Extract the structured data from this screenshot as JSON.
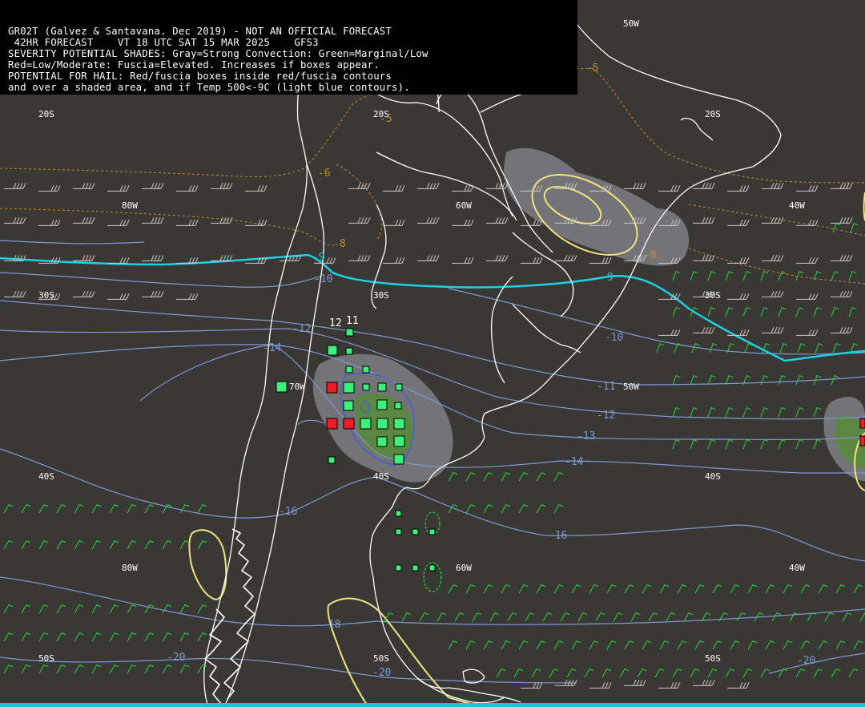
{
  "header": {
    "lines": [
      "GR02T (Galvez & Santavana. Dec 2019) - NOT AN OFFICIAL FORECAST",
      " 42HR FORECAST    VT 18 UTC SAT 15 MAR 2025    GFS3",
      "SEVERITY POTENTIAL SHADES: Gray=Strong Convection: Green=Marginal/Low",
      "Red=Low/Moderate: Fuscia=Elevated. Increases if boxes appear.",
      "POTENTIAL FOR HAIL: Red/fuscia boxes inside red/fuscia contours",
      "and over a shaded area, and if Temp 500<-9C (light blue contours)."
    ]
  },
  "grid_labels": {
    "lat_20s": "20S",
    "lat_30s": "30S",
    "lat_40s": "40S",
    "lat_50s": "50S",
    "lon_80w": "80W",
    "lon_70w": "70W",
    "lon_60w": "60W",
    "lon_50w": "50W",
    "lon_40w": "40W"
  },
  "temp_labels": [
    "-9",
    "-9",
    "-10",
    "-10",
    "-11",
    "-12",
    "-12",
    "-13",
    "-14",
    "-14",
    "-16",
    "-16",
    "-18",
    "-20",
    "-20",
    "-20"
  ],
  "other_labels": [
    "-5",
    "-5",
    "-6",
    "-8",
    "-8",
    "12",
    "11"
  ],
  "colors": {
    "background": "#3a3835",
    "coastline": "#ffffff",
    "temp_contour": "#7e98d6",
    "minus9_contour": "#1ecfe6",
    "yellow_contour": "#efe480",
    "orange_contour": "#c98a2c",
    "green_box": "#3cf07a",
    "red_box": "#ee1c24",
    "wind_barb": "#27d83a",
    "gray_shade": "#7a7a80",
    "green_shade": "#5a8a3c"
  }
}
